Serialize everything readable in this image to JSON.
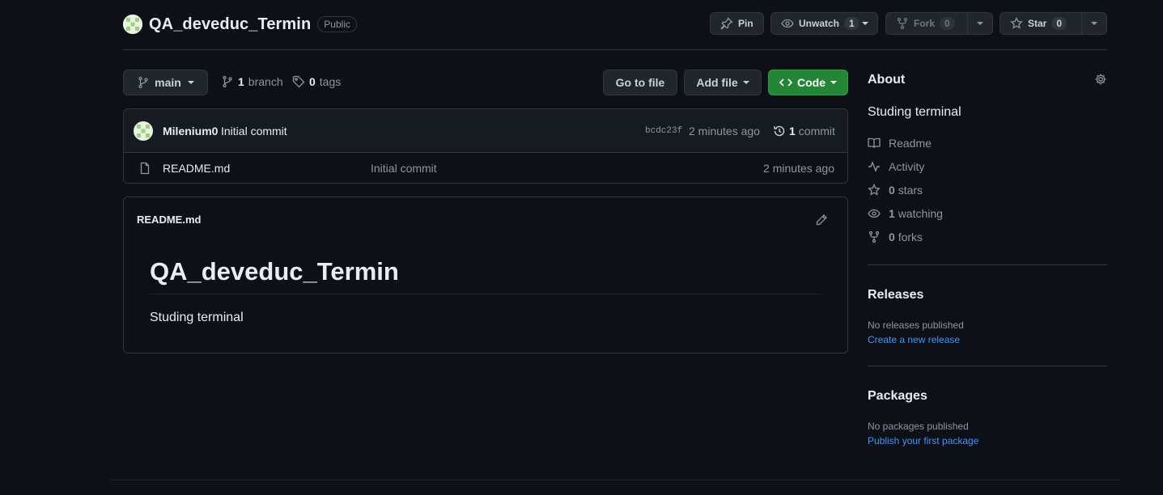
{
  "header": {
    "repo_name": "QA_deveduc_Termin",
    "visibility": "Public",
    "pin_label": "Pin",
    "watch_label": "Unwatch",
    "watch_count": "1",
    "fork_label": "Fork",
    "fork_count": "0",
    "star_label": "Star",
    "star_count": "0"
  },
  "toolbar": {
    "branch_selected": "main",
    "branch_count": "1",
    "branch_word": "branch",
    "tag_count": "0",
    "tag_word": "tags",
    "go_to_file": "Go to file",
    "add_file": "Add file",
    "code": "Code"
  },
  "latest_commit": {
    "author": "Milenium0",
    "message": "Initial commit",
    "sha": "bcdc23f",
    "time": "2 minutes ago",
    "commit_count": "1",
    "commit_word": "commit"
  },
  "files": [
    {
      "name": "README.md",
      "message": "Initial commit",
      "time": "2 minutes ago"
    }
  ],
  "readme": {
    "filename": "README.md",
    "heading": "QA_deveduc_Termin",
    "body": "Studing terminal"
  },
  "about": {
    "title": "About",
    "description": "Studing terminal",
    "readme_label": "Readme",
    "activity_label": "Activity",
    "stars_count": "0",
    "stars_word": "stars",
    "watching_count": "1",
    "watching_word": "watching",
    "forks_count": "0",
    "forks_word": "forks"
  },
  "releases": {
    "title": "Releases",
    "empty_text": "No releases published",
    "create_link": "Create a new release"
  },
  "packages": {
    "title": "Packages",
    "empty_text": "No packages published",
    "publish_link": "Publish your first package"
  },
  "colors": {
    "background": "#0d1117",
    "border": "#30363d",
    "accent_green": "#238636",
    "link_blue": "#4493f8",
    "muted_text": "#8d96a0"
  }
}
